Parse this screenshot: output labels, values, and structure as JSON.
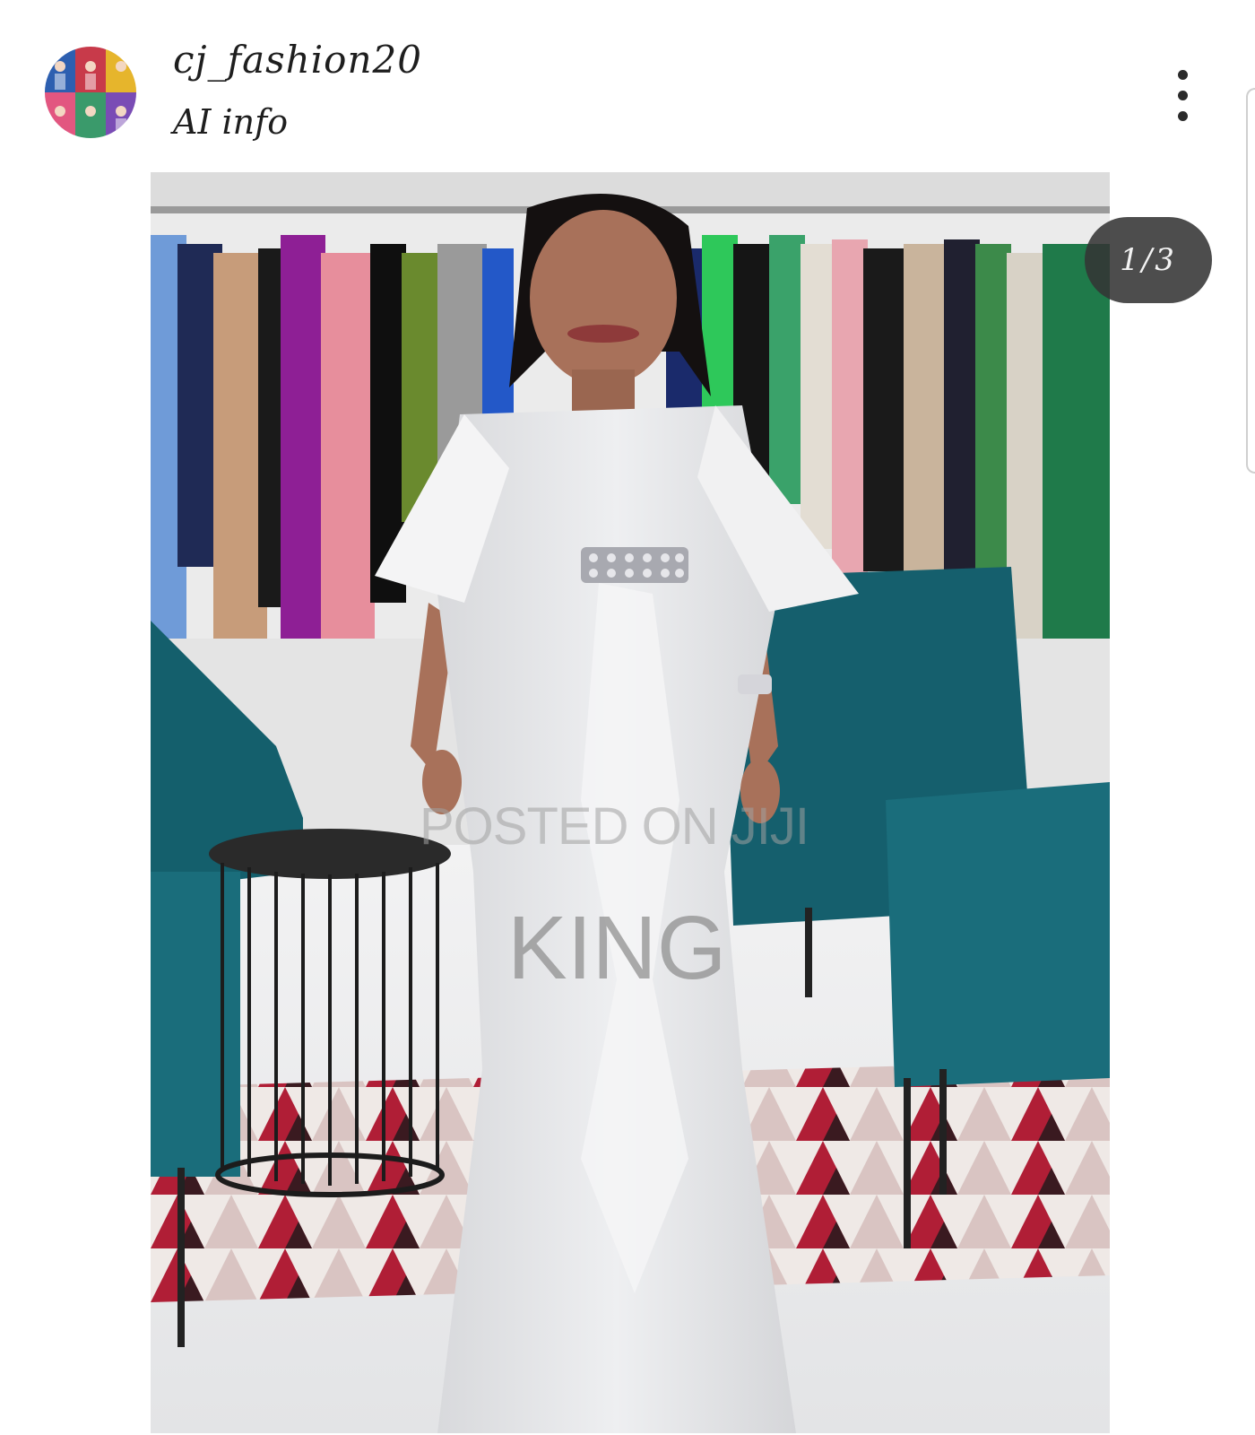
{
  "post": {
    "username": "cj_fashion20",
    "subtitle": "AI info",
    "more_icon": "more-vertical-icon",
    "counter": "1/3"
  },
  "photo": {
    "watermark_line1": "POSTED ON JIJI",
    "watermark_line2": "KING"
  },
  "colors": {
    "dress": "#e4e5e7",
    "chair": "#145f6c",
    "rug_red": "#b01e36",
    "badge_bg": "#343434"
  }
}
